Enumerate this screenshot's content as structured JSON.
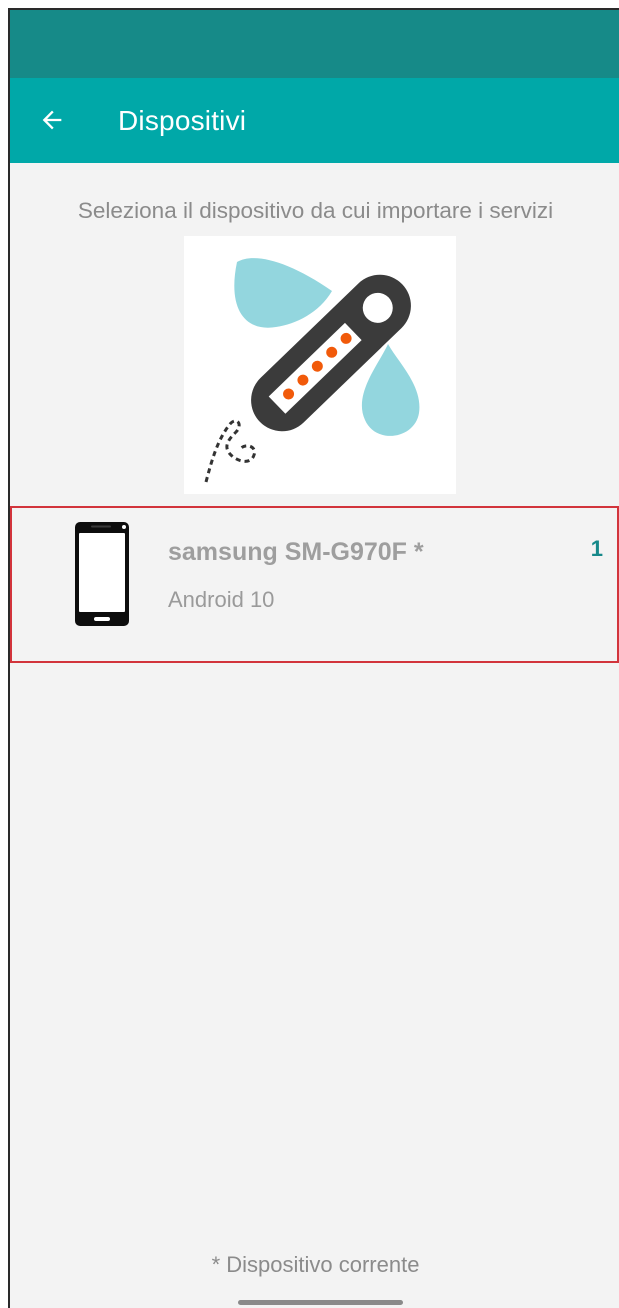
{
  "app_bar": {
    "title": "Dispositivi",
    "back_icon": "arrow-left-icon"
  },
  "content": {
    "instruction": "Seleziona il dispositivo da cui importare i servizi",
    "illustration_icon": "usb-key-import-illustration"
  },
  "devices": [
    {
      "name": "samsung SM-G970F *",
      "os": "Android 10",
      "count": "1",
      "icon": "smartphone-icon"
    }
  ],
  "footer": {
    "note": "* Dispositivo corrente"
  },
  "colors": {
    "status_bar": "#168a88",
    "app_bar": "#00a8a8",
    "accent": "#16898a",
    "selection_border": "#d2343b"
  }
}
